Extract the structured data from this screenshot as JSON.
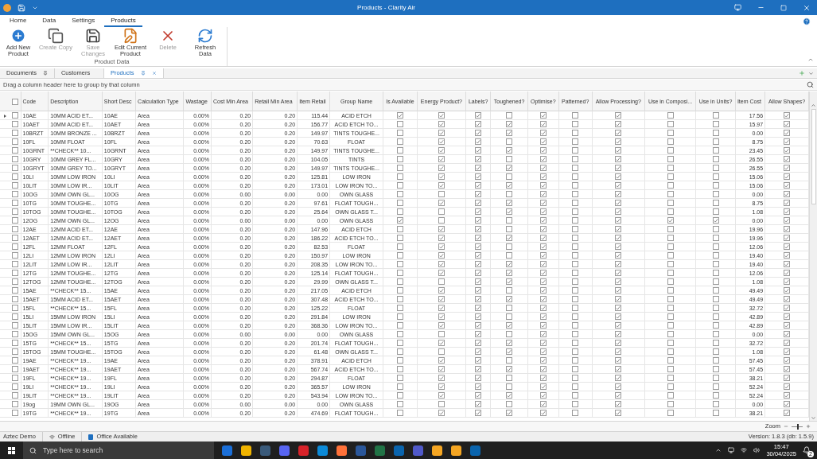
{
  "window": {
    "title": "Products - Clarity Air"
  },
  "ribbon_tabs": [
    {
      "label": "Home",
      "selected": false
    },
    {
      "label": "Data",
      "selected": false
    },
    {
      "label": "Settings",
      "selected": false
    },
    {
      "label": "Products",
      "selected": true
    }
  ],
  "ribbon_buttons": [
    {
      "label": "Add New Product",
      "kind": "add",
      "disabled": false
    },
    {
      "label": "Create Copy",
      "kind": "copy",
      "disabled": true
    },
    {
      "label": "Save Changes",
      "kind": "save",
      "disabled": true
    },
    {
      "label": "Edit Current Product",
      "kind": "edit",
      "disabled": false
    },
    {
      "label": "Delete",
      "kind": "delete",
      "disabled": true
    },
    {
      "label": "Refresh Data",
      "kind": "refresh",
      "disabled": false
    }
  ],
  "ribbon_group": "Product Data",
  "doc_tabs": [
    {
      "label": "Documents",
      "selected": false,
      "kind": "pinned"
    },
    {
      "label": "Customers",
      "selected": false,
      "kind": "plain"
    },
    {
      "label": "Products",
      "selected": true,
      "kind": "closable"
    }
  ],
  "group_panel": "Drag a column header here to group by that column",
  "table": {
    "select_all": false,
    "columns": [
      {
        "label": "Code",
        "kind": "text"
      },
      {
        "label": "Description",
        "kind": "text"
      },
      {
        "label": "Short Desc",
        "kind": "text"
      },
      {
        "label": "Calculation Type",
        "kind": "text"
      },
      {
        "label": "Wastage",
        "kind": "number"
      },
      {
        "label": "Cost Min Area",
        "kind": "number"
      },
      {
        "label": "Retail Min Area",
        "kind": "number"
      },
      {
        "label": "Item Retail",
        "kind": "number"
      },
      {
        "label": "Group Name",
        "kind": "center"
      },
      {
        "label": "Is Available",
        "kind": "check"
      },
      {
        "label": "Energy Product?",
        "kind": "check"
      },
      {
        "label": "Labels?",
        "kind": "check"
      },
      {
        "label": "Toughened?",
        "kind": "check"
      },
      {
        "label": "Optimise?",
        "kind": "check"
      },
      {
        "label": "Patterned?",
        "kind": "check"
      },
      {
        "label": "Allow Processing?",
        "kind": "check"
      },
      {
        "label": "Use in Composi...",
        "kind": "check"
      },
      {
        "label": "Use in Units?",
        "kind": "check"
      },
      {
        "label": "Item Cost",
        "kind": "number"
      },
      {
        "label": "Allow Shapes?",
        "kind": "check"
      }
    ],
    "rows": [
      {
        "selected": true,
        "checked": false,
        "cells": [
          "10AE",
          "10MM ACID ET...",
          "10AE",
          "Area",
          "0.00%",
          "0.20",
          "0.20",
          "115.44",
          "ACID ETCH",
          true,
          true,
          true,
          false,
          true,
          false,
          true,
          false,
          false,
          "17.56",
          true
        ]
      },
      {
        "selected": false,
        "checked": false,
        "cells": [
          "10AET",
          "10MM ACID ET...",
          "10AET",
          "Area",
          "0.00%",
          "0.20",
          "0.20",
          "156.77",
          "ACID ETCH TO...",
          false,
          true,
          true,
          true,
          true,
          false,
          true,
          false,
          false,
          "15.97",
          true
        ]
      },
      {
        "selected": false,
        "checked": false,
        "cells": [
          "10BRZT",
          "10MM BRONZE ...",
          "10BRZT",
          "Area",
          "0.00%",
          "0.20",
          "0.20",
          "149.97",
          "TINTS TOUGHE...",
          false,
          true,
          true,
          true,
          true,
          false,
          true,
          false,
          false,
          "0.00",
          true
        ]
      },
      {
        "selected": false,
        "checked": false,
        "cells": [
          "10FL",
          "10MM FLOAT",
          "10FL",
          "Area",
          "0.00%",
          "0.20",
          "0.20",
          "70.63",
          "FLOAT",
          false,
          true,
          true,
          false,
          true,
          false,
          true,
          false,
          false,
          "8.75",
          true
        ]
      },
      {
        "selected": false,
        "checked": false,
        "cells": [
          "10GRNT",
          "**CHECK** 10...",
          "10GRNT",
          "Area",
          "0.00%",
          "0.20",
          "0.20",
          "149.97",
          "TINTS TOUGHE...",
          false,
          true,
          true,
          true,
          true,
          false,
          true,
          false,
          false,
          "23.45",
          true
        ]
      },
      {
        "selected": false,
        "checked": false,
        "cells": [
          "10GRY",
          "10MM GREY FL...",
          "10GRY",
          "Area",
          "0.00%",
          "0.20",
          "0.20",
          "104.05",
          "TINTS",
          false,
          true,
          true,
          false,
          true,
          false,
          true,
          false,
          false,
          "26.55",
          true
        ]
      },
      {
        "selected": false,
        "checked": false,
        "cells": [
          "10GRYT",
          "10MM GREY TO...",
          "10GRYT",
          "Area",
          "0.00%",
          "0.20",
          "0.20",
          "149.97",
          "TINTS TOUGHE...",
          false,
          true,
          true,
          true,
          true,
          false,
          true,
          false,
          false,
          "26.55",
          true
        ]
      },
      {
        "selected": false,
        "checked": false,
        "cells": [
          "10LI",
          "10MM LOW IRON",
          "10LI",
          "Area",
          "0.00%",
          "0.20",
          "0.20",
          "125.81",
          "LOW IRON",
          false,
          true,
          true,
          false,
          true,
          false,
          true,
          false,
          false,
          "15.06",
          true
        ]
      },
      {
        "selected": false,
        "checked": false,
        "cells": [
          "10LIT",
          "10MM LOW IR...",
          "10LIT",
          "Area",
          "0.00%",
          "0.20",
          "0.20",
          "173.01",
          "LOW IRON TO...",
          false,
          true,
          true,
          true,
          true,
          false,
          true,
          false,
          false,
          "15.06",
          true
        ]
      },
      {
        "selected": false,
        "checked": false,
        "cells": [
          "10OG",
          "10MM OWN GL...",
          "10OG",
          "Area",
          "0.00%",
          "0.00",
          "0.00",
          "0.00",
          "OWN GLASS",
          false,
          false,
          true,
          false,
          true,
          false,
          true,
          false,
          false,
          "0.00",
          true
        ]
      },
      {
        "selected": false,
        "checked": false,
        "cells": [
          "10TG",
          "10MM TOUGHE...",
          "10TG",
          "Area",
          "0.00%",
          "0.20",
          "0.20",
          "97.61",
          "FLOAT TOUGH...",
          false,
          true,
          true,
          true,
          true,
          false,
          true,
          false,
          false,
          "8.75",
          true
        ]
      },
      {
        "selected": false,
        "checked": false,
        "cells": [
          "10TOG",
          "10MM TOUGHE...",
          "10TOG",
          "Area",
          "0.00%",
          "0.20",
          "0.20",
          "25.64",
          "OWN GLASS T...",
          false,
          false,
          true,
          true,
          true,
          false,
          true,
          false,
          false,
          "1.08",
          true
        ]
      },
      {
        "selected": false,
        "checked": false,
        "cells": [
          "12OG",
          "12MM OWN GL...",
          "12OG",
          "Area",
          "0.00%",
          "0.00",
          "0.00",
          "0.00",
          "OWN GLASS",
          true,
          false,
          true,
          false,
          true,
          false,
          true,
          true,
          true,
          "0.00",
          true
        ]
      },
      {
        "selected": false,
        "checked": false,
        "cells": [
          "12AE",
          "12MM ACID ET...",
          "12AE",
          "Area",
          "0.00%",
          "0.20",
          "0.20",
          "147.96",
          "ACID ETCH",
          false,
          true,
          true,
          false,
          true,
          false,
          true,
          false,
          false,
          "19.96",
          true
        ]
      },
      {
        "selected": false,
        "checked": false,
        "cells": [
          "12AET",
          "12MM ACID ET...",
          "12AET",
          "Area",
          "0.00%",
          "0.20",
          "0.20",
          "186.22",
          "ACID ETCH TO...",
          false,
          true,
          true,
          true,
          true,
          false,
          true,
          false,
          false,
          "19.96",
          true
        ]
      },
      {
        "selected": false,
        "checked": false,
        "cells": [
          "12FL",
          "12MM FLOAT",
          "12FL",
          "Area",
          "0.00%",
          "0.20",
          "0.20",
          "82.53",
          "FLOAT",
          false,
          true,
          true,
          false,
          true,
          false,
          true,
          false,
          false,
          "12.06",
          true
        ]
      },
      {
        "selected": false,
        "checked": false,
        "cells": [
          "12LI",
          "12MM LOW IRON",
          "12LI",
          "Area",
          "0.00%",
          "0.20",
          "0.20",
          "150.97",
          "LOW IRON",
          false,
          true,
          true,
          false,
          true,
          false,
          true,
          false,
          false,
          "19.40",
          true
        ]
      },
      {
        "selected": false,
        "checked": false,
        "cells": [
          "12LIT",
          "12MM LOW IR...",
          "12LIT",
          "Area",
          "0.00%",
          "0.20",
          "0.20",
          "208.35",
          "LOW IRON TO...",
          false,
          true,
          true,
          true,
          true,
          false,
          true,
          false,
          false,
          "19.40",
          true
        ]
      },
      {
        "selected": false,
        "checked": false,
        "cells": [
          "12TG",
          "12MM TOUGHE...",
          "12TG",
          "Area",
          "0.00%",
          "0.20",
          "0.20",
          "125.14",
          "FLOAT TOUGH...",
          false,
          true,
          true,
          true,
          true,
          false,
          true,
          false,
          false,
          "12.06",
          true
        ]
      },
      {
        "selected": false,
        "checked": false,
        "cells": [
          "12TOG",
          "12MM TOUGHE...",
          "12TOG",
          "Area",
          "0.00%",
          "0.20",
          "0.20",
          "29.99",
          "OWN GLASS T...",
          false,
          false,
          true,
          true,
          true,
          false,
          true,
          false,
          false,
          "1.08",
          true
        ]
      },
      {
        "selected": false,
        "checked": false,
        "cells": [
          "15AE",
          "**CHECK** 15...",
          "15AE",
          "Area",
          "0.00%",
          "0.20",
          "0.20",
          "217.05",
          "ACID ETCH",
          false,
          true,
          true,
          false,
          true,
          false,
          true,
          false,
          false,
          "49.49",
          true
        ]
      },
      {
        "selected": false,
        "checked": false,
        "cells": [
          "15AET",
          "15MM ACID ET...",
          "15AET",
          "Area",
          "0.00%",
          "0.20",
          "0.20",
          "307.48",
          "ACID ETCH TO...",
          false,
          true,
          true,
          true,
          true,
          false,
          true,
          false,
          false,
          "49.49",
          true
        ]
      },
      {
        "selected": false,
        "checked": false,
        "cells": [
          "15FL",
          "**CHECK** 15...",
          "15FL",
          "Area",
          "0.00%",
          "0.20",
          "0.20",
          "125.22",
          "FLOAT",
          false,
          true,
          true,
          false,
          true,
          false,
          true,
          false,
          false,
          "32.72",
          true
        ]
      },
      {
        "selected": false,
        "checked": false,
        "cells": [
          "15LI",
          "15MM LOW IRON",
          "15LI",
          "Area",
          "0.00%",
          "0.20",
          "0.20",
          "291.84",
          "LOW IRON",
          false,
          true,
          true,
          false,
          true,
          false,
          true,
          false,
          false,
          "42.89",
          true
        ]
      },
      {
        "selected": false,
        "checked": false,
        "cells": [
          "15LIT",
          "15MM LOW IR...",
          "15LIT",
          "Area",
          "0.00%",
          "0.20",
          "0.20",
          "368.36",
          "LOW IRON TO...",
          false,
          true,
          true,
          true,
          true,
          false,
          true,
          false,
          false,
          "42.89",
          true
        ]
      },
      {
        "selected": false,
        "checked": false,
        "cells": [
          "15OG",
          "15MM OWN GL...",
          "15OG",
          "Area",
          "0.00%",
          "0.00",
          "0.00",
          "0.00",
          "OWN GLASS",
          false,
          false,
          true,
          false,
          true,
          false,
          true,
          false,
          false,
          "0.00",
          true
        ]
      },
      {
        "selected": false,
        "checked": false,
        "cells": [
          "15TG",
          "**CHECK** 15...",
          "15TG",
          "Area",
          "0.00%",
          "0.20",
          "0.20",
          "201.74",
          "FLOAT TOUGH...",
          false,
          true,
          true,
          true,
          true,
          false,
          true,
          false,
          false,
          "32.72",
          true
        ]
      },
      {
        "selected": false,
        "checked": false,
        "cells": [
          "15TOG",
          "15MM TOUGHE...",
          "15TOG",
          "Area",
          "0.00%",
          "0.20",
          "0.20",
          "61.48",
          "OWN GLASS T...",
          false,
          false,
          true,
          true,
          true,
          false,
          true,
          false,
          false,
          "1.08",
          true
        ]
      },
      {
        "selected": false,
        "checked": false,
        "cells": [
          "19AE",
          "**CHECK** 19...",
          "19AE",
          "Area",
          "0.00%",
          "0.20",
          "0.20",
          "378.91",
          "ACID ETCH",
          false,
          true,
          true,
          false,
          true,
          false,
          true,
          false,
          false,
          "57.45",
          true
        ]
      },
      {
        "selected": false,
        "checked": false,
        "cells": [
          "19AET",
          "**CHECK** 19...",
          "19AET",
          "Area",
          "0.00%",
          "0.20",
          "0.20",
          "567.74",
          "ACID ETCH TO...",
          false,
          true,
          true,
          true,
          true,
          false,
          true,
          false,
          false,
          "57.45",
          true
        ]
      },
      {
        "selected": false,
        "checked": false,
        "cells": [
          "19FL",
          "**CHECK** 19...",
          "19FL",
          "Area",
          "0.00%",
          "0.20",
          "0.20",
          "294.87",
          "FLOAT",
          false,
          true,
          true,
          false,
          true,
          false,
          true,
          false,
          false,
          "38.21",
          true
        ]
      },
      {
        "selected": false,
        "checked": false,
        "cells": [
          "19LI",
          "**CHECK** 19...",
          "19LI",
          "Area",
          "0.00%",
          "0.20",
          "0.20",
          "365.57",
          "LOW IRON",
          false,
          true,
          true,
          false,
          true,
          false,
          true,
          false,
          false,
          "52.24",
          true
        ]
      },
      {
        "selected": false,
        "checked": false,
        "cells": [
          "19LIT",
          "**CHECK** 19...",
          "19LIT",
          "Area",
          "0.00%",
          "0.20",
          "0.20",
          "543.94",
          "LOW IRON TO...",
          false,
          true,
          true,
          true,
          true,
          false,
          true,
          false,
          false,
          "52.24",
          true
        ]
      },
      {
        "selected": false,
        "checked": false,
        "cells": [
          "19og",
          "19MM OWN GL...",
          "19OG",
          "Area",
          "0.00%",
          "0.00",
          "0.00",
          "0.00",
          "OWN GLASS",
          false,
          false,
          true,
          false,
          true,
          false,
          true,
          false,
          false,
          "0.00",
          true
        ]
      },
      {
        "selected": false,
        "checked": false,
        "cells": [
          "19TG",
          "**CHECK** 19...",
          "19TG",
          "Area",
          "0.00%",
          "0.20",
          "0.20",
          "474.69",
          "FLOAT TOUGH...",
          false,
          true,
          true,
          true,
          true,
          false,
          true,
          false,
          false,
          "38.21",
          true
        ]
      }
    ]
  },
  "zoom": {
    "label": "Zoom",
    "level": 0.6
  },
  "status_bar": {
    "company": "Aztec Demo",
    "connection": "Offline",
    "office": "Office Available",
    "version": "Version: 1.8.3 (db: 1.5.9)"
  },
  "taskbar": {
    "search_placeholder": "Type here to search",
    "time": "15:47",
    "date": "30/04/2025",
    "notifications": "2"
  }
}
